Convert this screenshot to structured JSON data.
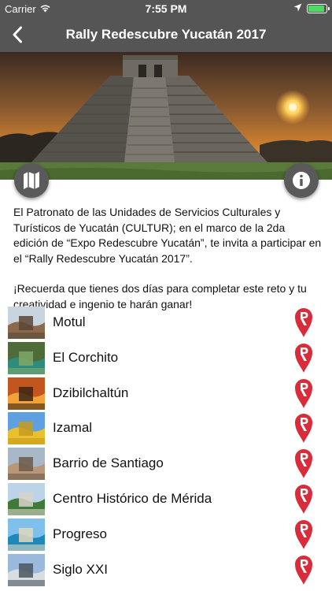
{
  "status_bar": {
    "carrier": "Carrier",
    "time": "7:55 PM",
    "battery_level": 0.9
  },
  "nav": {
    "title": "Rally Redescubre Yucatán 2017",
    "back_icon": "chevron-left-icon"
  },
  "hero": {
    "map_icon": "map-icon",
    "info_icon": "info-icon"
  },
  "description": {
    "paragraph1": "El Patronato de las Unidades de Servicios Culturales y Turísticos de Yucatán (CULTUR); en el marco de la 2da edición de “Expo Redescubre Yucatán”, te invita a participar en el “Rally Redescubre Yucatán 2017”.",
    "paragraph2": "¡Recuerda que tienes dos días para completar este reto y tu creatividad e ingenio te harán ganar!"
  },
  "places": [
    {
      "name": "Motul",
      "thumb_colors": [
        "#c9d4de",
        "#8a6a4a",
        "#5b4736"
      ]
    },
    {
      "name": "El Corchito",
      "thumb_colors": [
        "#4f6b3a",
        "#2f8c7a",
        "#7ea86a"
      ]
    },
    {
      "name": "Dzibilchaltún",
      "thumb_colors": [
        "#c2561e",
        "#f2a23a",
        "#3a2414"
      ]
    },
    {
      "name": "Izamal",
      "thumb_colors": [
        "#5ea0e0",
        "#e8c030",
        "#c89a1c"
      ]
    },
    {
      "name": "Barrio de Santiago",
      "thumb_colors": [
        "#a9b8c6",
        "#b8967a",
        "#6c5a4a"
      ]
    },
    {
      "name": "Centro Histórico de Mérida",
      "thumb_colors": [
        "#bcd3e8",
        "#3f7a3a",
        "#d8d2c8"
      ]
    },
    {
      "name": "Progreso",
      "thumb_colors": [
        "#7fc0ea",
        "#1f88b8",
        "#e0d8c0"
      ]
    },
    {
      "name": "Siglo XXI",
      "thumb_colors": [
        "#9ab9dc",
        "#d8dde2",
        "#4a5560"
      ]
    }
  ],
  "colors": {
    "bar": "#555555",
    "pin": "#d92b3a",
    "battery": "#4cd964"
  }
}
